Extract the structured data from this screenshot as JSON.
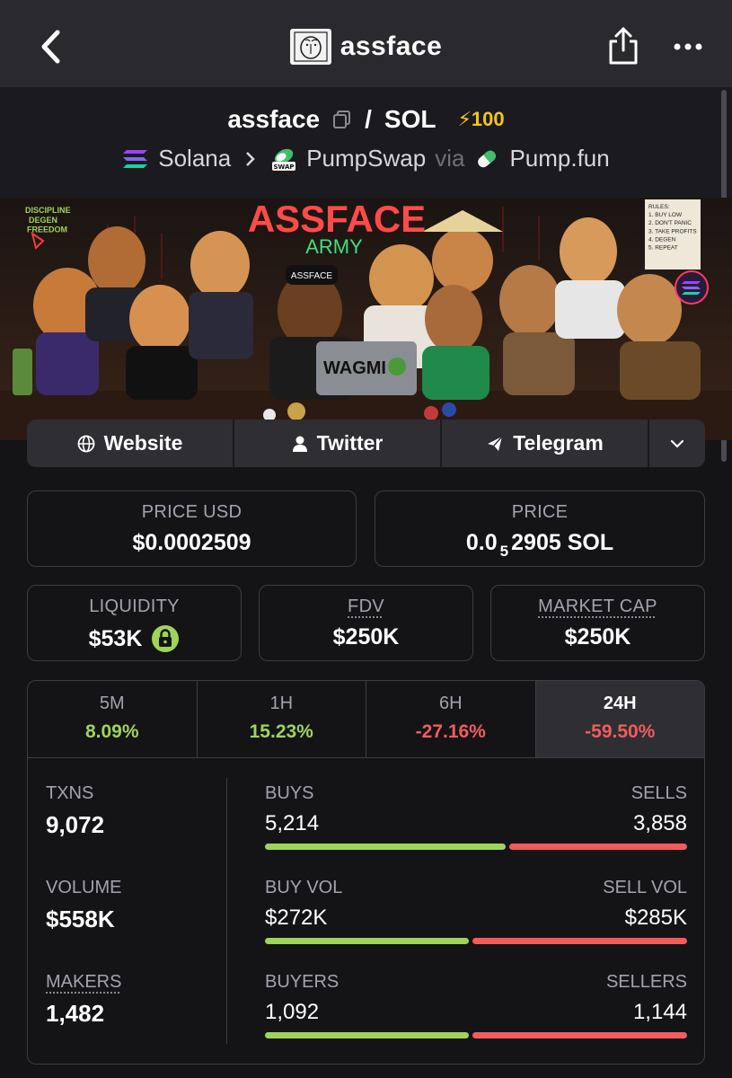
{
  "header": {
    "title": "assface"
  },
  "pair": {
    "base": "assface",
    "separator": "/",
    "quote": "SOL",
    "boost": "⚡100"
  },
  "route": {
    "chain": "Solana",
    "dex": "PumpSwap",
    "via": "via",
    "launchpad": "Pump.fun"
  },
  "banner": {
    "title": "ASSFACE",
    "subtitle": "ARMY",
    "sign_left": "DISCIPLINE\nDEGEN\nFREEDOM",
    "rules": "RULES:\n1. BUY LOW\n2. DON'T PANIC\n3. TAKE PROFITS\n4. DEGEN\n5. REPEAT",
    "laptop_text": "WAGMI",
    "cap_text": "ASSFACE"
  },
  "links": {
    "website": "Website",
    "twitter": "Twitter",
    "telegram": "Telegram"
  },
  "price": {
    "usd_label": "PRICE USD",
    "usd_value": "$0.0002509",
    "sol_label": "PRICE",
    "sol_prefix": "0.0",
    "sol_zeros": "5",
    "sol_rest": "2905 SOL"
  },
  "metrics": {
    "liquidity_label": "LIQUIDITY",
    "liquidity_value": "$53K",
    "fdv_label": "FDV",
    "fdv_value": "$250K",
    "mcap_label": "MARKET CAP",
    "mcap_value": "$250K"
  },
  "timeframes": [
    {
      "label": "5M",
      "value": "8.09%"
    },
    {
      "label": "1H",
      "value": "15.23%"
    },
    {
      "label": "6H",
      "value": "-27.16%"
    },
    {
      "label": "24H",
      "value": "-59.50%"
    }
  ],
  "stats": {
    "txns_label": "TXNS",
    "txns_value": "9,072",
    "volume_label": "VOLUME",
    "volume_value": "$558K",
    "makers_label": "MAKERS",
    "makers_value": "1,482",
    "buys_label": "BUYS",
    "buys_value": "5,214",
    "sells_label": "SELLS",
    "sells_value": "3,858",
    "buyvol_label": "BUY VOL",
    "buyvol_value": "$272K",
    "sellvol_label": "SELL VOL",
    "sellvol_value": "$285K",
    "buyers_label": "BUYERS",
    "buyers_value": "1,092",
    "sellers_label": "SELLERS",
    "sellers_value": "1,144",
    "buy_share_txns": 0.575,
    "buy_share_vol": 0.488,
    "buy_share_makers": 0.488
  },
  "colors": {
    "positive": "#9fd45a",
    "negative": "#f25c5c",
    "boost": "#f5c518"
  }
}
